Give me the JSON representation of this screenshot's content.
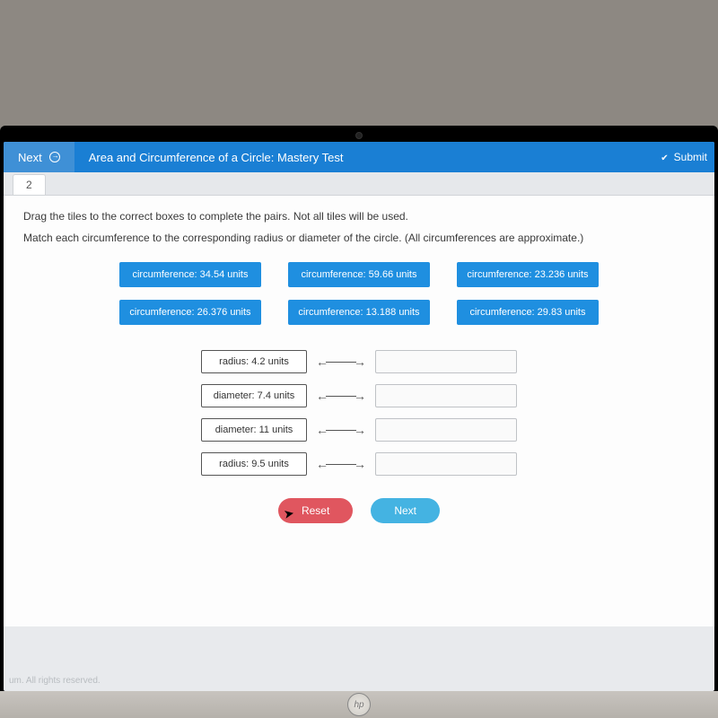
{
  "topbar": {
    "next_label": "Next",
    "title": "Area and Circumference of a Circle: Mastery Test",
    "submit_label": "Submit"
  },
  "tab": {
    "number": "2"
  },
  "instructions": {
    "line1": "Drag the tiles to the correct boxes to complete the pairs. Not all tiles will be used.",
    "line2": "Match each circumference to the corresponding radius or diameter of the circle. (All circumferences are approximate.)"
  },
  "tiles": {
    "row1": [
      "circumference: 34.54 units",
      "circumference: 59.66 units",
      "circumference: 23.236 units"
    ],
    "row2": [
      "circumference: 26.376 units",
      "circumference: 13.188 units",
      "circumference: 29.83 units"
    ]
  },
  "matches": [
    "radius: 4.2 units",
    "diameter: 7.4 units",
    "diameter: 11 units",
    "radius: 9.5 units"
  ],
  "buttons": {
    "reset": "Reset",
    "next": "Next"
  },
  "footer": "um. All rights reserved.",
  "logo": "hp"
}
